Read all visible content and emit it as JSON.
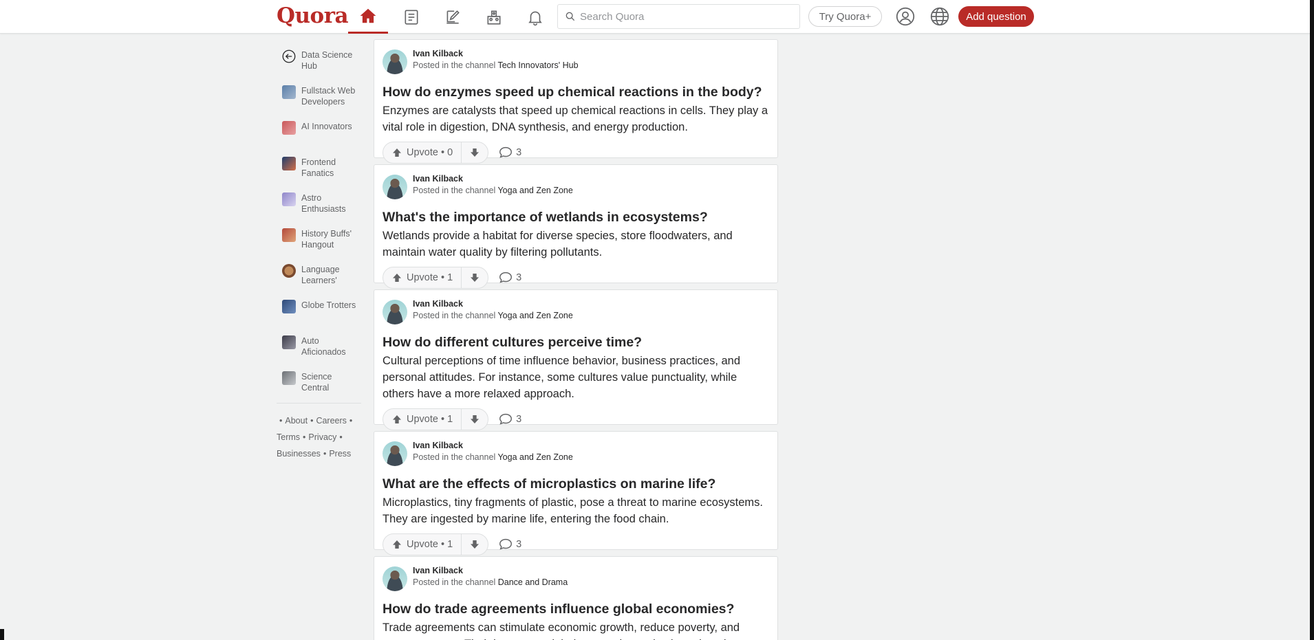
{
  "header": {
    "logo": "Quora",
    "search_placeholder": "Search Quora",
    "try_plus": "Try Quora+",
    "add_question": "Add question",
    "brand_color": "#b92b27",
    "nav_icons": [
      "home-icon",
      "following-icon",
      "answer-icon",
      "spaces-icon",
      "notifications-icon"
    ]
  },
  "sidebar": {
    "items": [
      {
        "label": "Data Science Hub",
        "icon": "back-arrow-icon"
      },
      {
        "label": "Fullstack Web Developers",
        "color": "#5b7fa8"
      },
      {
        "label": "AI Innovators",
        "color": "#c9585a"
      },
      {
        "label": "Frontend Fanatics",
        "color": "#d3704a"
      },
      {
        "label": "Astro Enthusiasts",
        "color": "#8f86c9"
      },
      {
        "label": "History Buffs' Hangout",
        "color": "#b3493b"
      },
      {
        "label": "Language Learners' Lounge",
        "color": "#7a4a2f"
      },
      {
        "label": "Globe Trotters",
        "color": "#2f4a78"
      },
      {
        "label": "Auto Aficionados",
        "color": "#3b3b48"
      },
      {
        "label": "Science Central",
        "color": "#6b6f74"
      }
    ]
  },
  "footer": {
    "about": "About",
    "careers": "Careers",
    "terms": "Terms",
    "privacy": "Privacy",
    "businesses": "Businesses",
    "press": "Press"
  },
  "feed": {
    "posted_prefix": "Posted in the channel",
    "upvote_label": "Upvote",
    "posts": [
      {
        "author": "Ivan Kilback",
        "channel": "Tech Innovators' Hub",
        "title": "How do enzymes speed up chemical reactions in the body?",
        "body": "Enzymes are catalysts that speed up chemical reactions in cells. They play a vital role in digestion, DNA synthesis, and energy production.",
        "upvotes": "0",
        "comments": "3"
      },
      {
        "author": "Ivan Kilback",
        "channel": "Yoga and Zen Zone",
        "title": "What's the importance of wetlands in ecosystems?",
        "body": "Wetlands provide a habitat for diverse species, store floodwaters, and maintain water quality by filtering pollutants.",
        "upvotes": "1",
        "comments": "3"
      },
      {
        "author": "Ivan Kilback",
        "channel": "Yoga and Zen Zone",
        "title": "How do different cultures perceive time?",
        "body": "Cultural perceptions of time influence behavior, business practices, and personal attitudes. For instance, some cultures value punctuality, while others have a more relaxed approach.",
        "upvotes": "1",
        "comments": "3"
      },
      {
        "author": "Ivan Kilback",
        "channel": "Yoga and Zen Zone",
        "title": "What are the effects of microplastics on marine life?",
        "body": "Microplastics, tiny fragments of plastic, pose a threat to marine ecosystems. They are ingested by marine life, entering the food chain.",
        "upvotes": "1",
        "comments": "3"
      },
      {
        "author": "Ivan Kilback",
        "channel": "Dance and Drama",
        "title": "How do trade agreements influence global economies?",
        "body": "Trade agreements can stimulate economic growth, reduce poverty, and promote peace. Their impact on global economies varies based on the",
        "upvotes": "",
        "comments": ""
      }
    ]
  }
}
